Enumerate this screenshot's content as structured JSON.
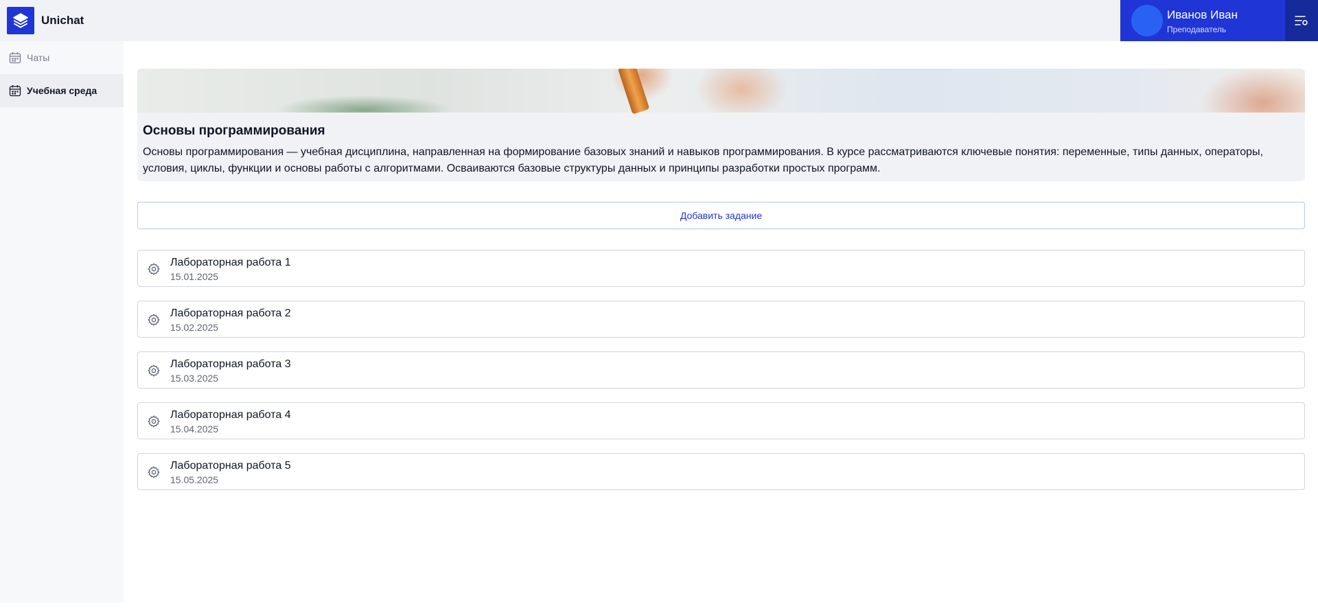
{
  "header": {
    "app_title": "Unichat",
    "logo_icon": "layers-icon",
    "menu_icon": "menu-settings-icon"
  },
  "user": {
    "name": "Иванов Иван",
    "role": "Преподаватель"
  },
  "sidebar": {
    "items": [
      {
        "label": "Чаты",
        "icon": "calendar-icon",
        "active": false
      },
      {
        "label": "Учебная среда",
        "icon": "calendar-icon",
        "active": true
      }
    ]
  },
  "course": {
    "title": "Основы программирования",
    "description": "Основы программирования — учебная дисциплина, направленная на формирование базовых знаний и навыков программирования. В курсе рассматриваются ключевые понятия: переменные, типы данных, операторы, условия, циклы, функции и основы работы с алгоритмами. Осваиваются базовые структуры данных и принципы разработки простых программ."
  },
  "actions": {
    "add_task_label": "Добавить задание"
  },
  "tasks": [
    {
      "title": "Лабораторная работа 1",
      "date": "15.01.2025"
    },
    {
      "title": "Лабораторная работа 2",
      "date": "15.02.2025"
    },
    {
      "title": "Лабораторная работа 3",
      "date": "15.03.2025"
    },
    {
      "title": "Лабораторная работа 4",
      "date": "15.04.2025"
    },
    {
      "title": "Лабораторная работа 5",
      "date": "15.05.2025"
    }
  ],
  "colors": {
    "accent": "#1f35d6",
    "header_bg": "#f1f2f6",
    "sidebar_bg": "#f7f8fa"
  }
}
